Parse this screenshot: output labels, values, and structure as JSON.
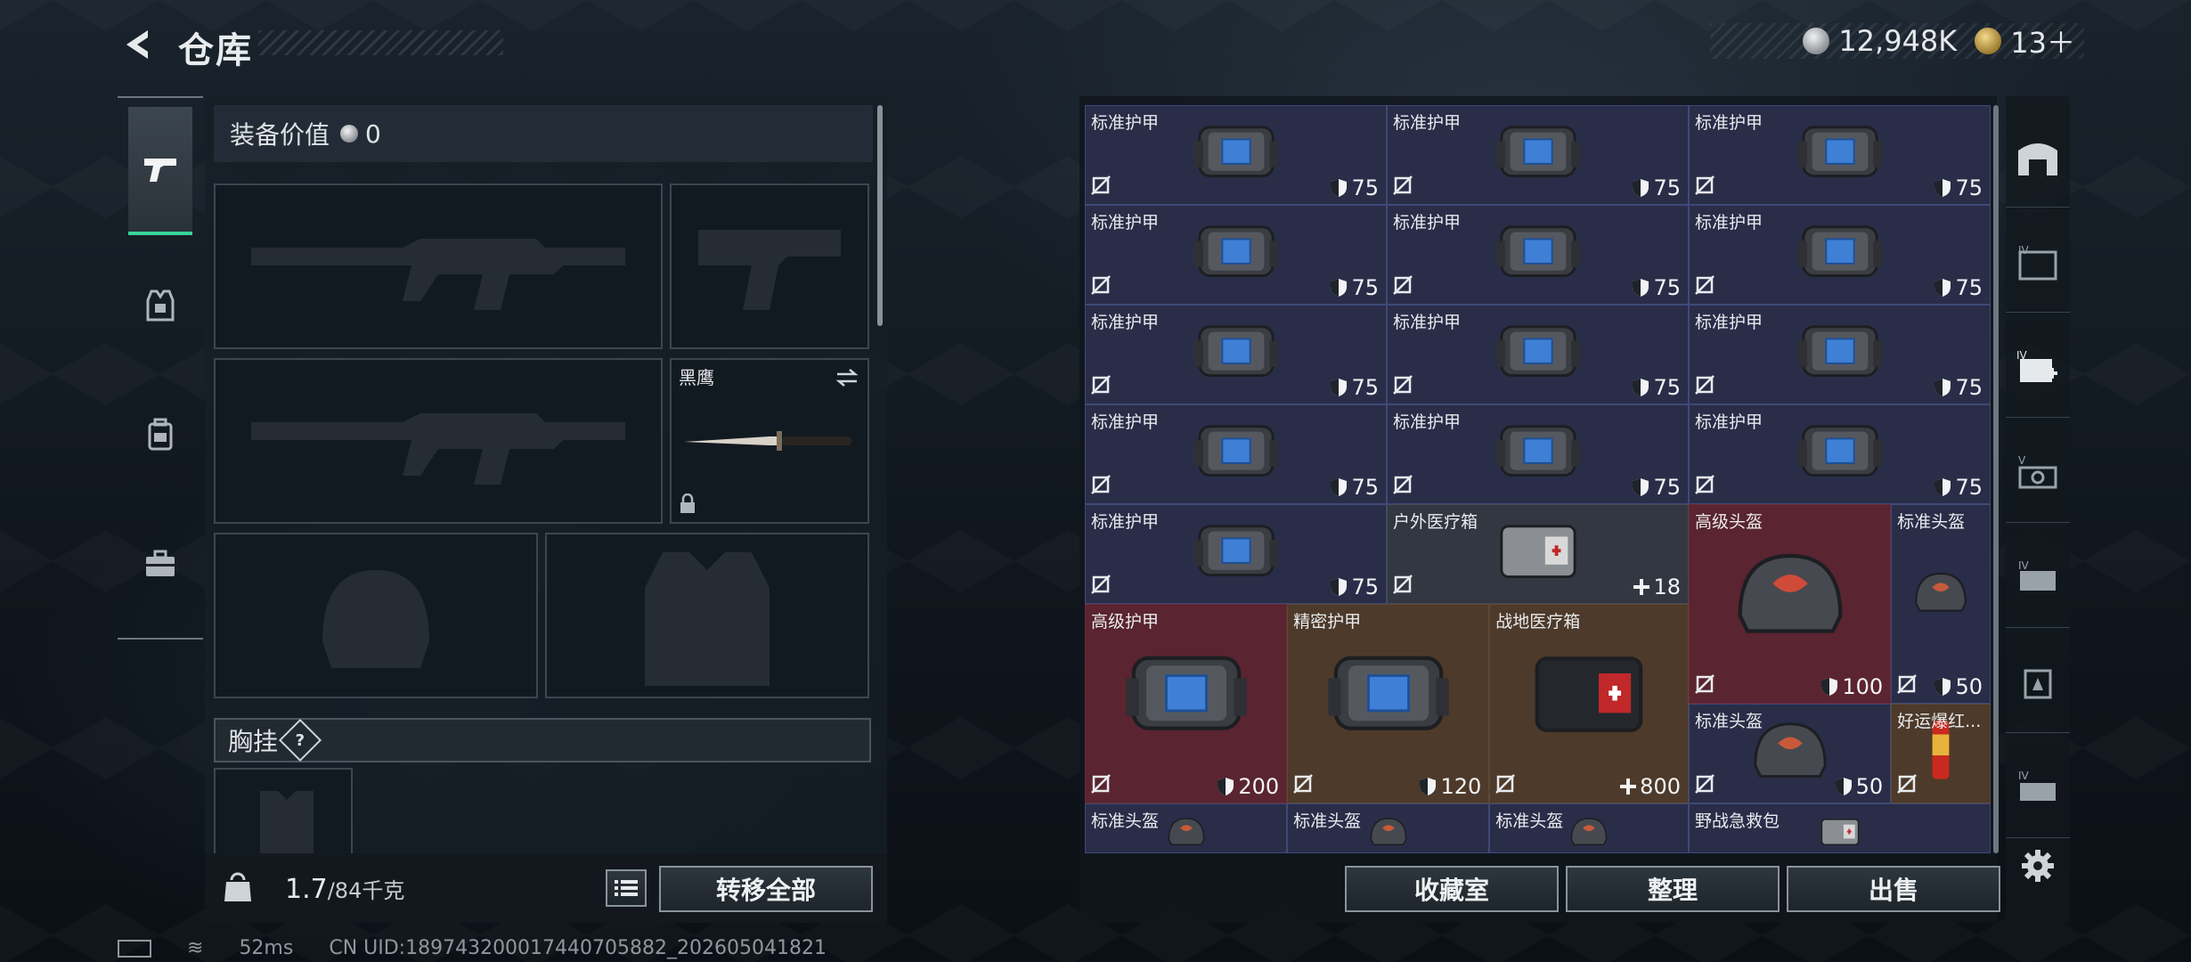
{
  "header": {
    "title": "仓库",
    "currency_silver": "12,948K",
    "currency_gold": "13＋"
  },
  "equipment": {
    "value_label": "装备价值",
    "value": "0",
    "melee_name": "黑鹰",
    "chest_label": "胸挂",
    "help_badge": "?",
    "weight_current": "1.7",
    "weight_max": "/84千克",
    "transfer_all": "转移全部"
  },
  "stash": {
    "items": [
      {
        "name": "标准护甲",
        "value": "75",
        "kind": "armor"
      },
      {
        "name": "标准护甲",
        "value": "75",
        "kind": "armor"
      },
      {
        "name": "标准护甲",
        "value": "75",
        "kind": "armor"
      },
      {
        "name": "标准护甲",
        "value": "75",
        "kind": "armor"
      },
      {
        "name": "标准护甲",
        "value": "75",
        "kind": "armor"
      },
      {
        "name": "标准护甲",
        "value": "75",
        "kind": "armor"
      },
      {
        "name": "标准护甲",
        "value": "75",
        "kind": "armor"
      },
      {
        "name": "标准护甲",
        "value": "75",
        "kind": "armor"
      },
      {
        "name": "标准护甲",
        "value": "75",
        "kind": "armor"
      },
      {
        "name": "标准护甲",
        "value": "75",
        "kind": "armor"
      },
      {
        "name": "标准护甲",
        "value": "75",
        "kind": "armor"
      },
      {
        "name": "标准护甲",
        "value": "75",
        "kind": "armor"
      },
      {
        "name": "标准护甲",
        "value": "75",
        "kind": "armor"
      },
      {
        "name": "户外医疗箱",
        "value": "18",
        "kind": "medkit"
      },
      {
        "name": "高级头盔",
        "value": "100",
        "kind": "helmet"
      },
      {
        "name": "标准头盔",
        "value": "50",
        "kind": "helmet"
      },
      {
        "name": "高级护甲",
        "value": "200",
        "kind": "armor"
      },
      {
        "name": "精密护甲",
        "value": "120",
        "kind": "armor"
      },
      {
        "name": "战地医疗箱",
        "value": "800",
        "kind": "medkit"
      },
      {
        "name": "标准头盔",
        "value": "50",
        "kind": "helmet"
      },
      {
        "name": "好运爆红...",
        "value": "",
        "kind": "firework"
      },
      {
        "name": "标准头盔",
        "value": "",
        "kind": "helmet"
      },
      {
        "name": "标准头盔",
        "value": "",
        "kind": "helmet"
      },
      {
        "name": "标准头盔",
        "value": "",
        "kind": "helmet"
      },
      {
        "name": "野战急救包",
        "value": "",
        "kind": "medkit"
      }
    ],
    "btn_collection": "收藏室",
    "btn_sort": "整理",
    "btn_sell": "出售"
  },
  "status": {
    "ping": "52ms",
    "uid": "CN UID:18974320001744070588​2_202605041821"
  },
  "colors": {
    "accent_green": "#38d39b",
    "cell_blue": "#2a2d48",
    "cell_red": "#5a2430",
    "cell_gold": "#4d3a2a"
  }
}
